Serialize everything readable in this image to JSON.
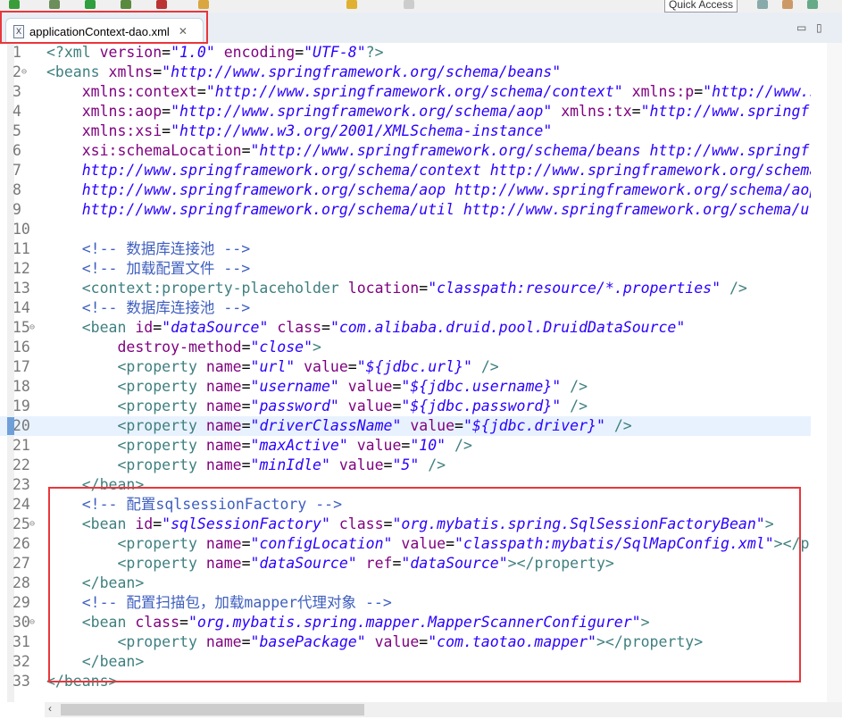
{
  "toolbar": {
    "quick_access": "Quick Access"
  },
  "tab": {
    "icon": "xml-file-icon",
    "label": "applicationContext-dao.xml",
    "close": "✕"
  },
  "colors": {
    "tag": "#3f7f7f",
    "attr": "#7f007f",
    "value": "#2a00ff",
    "comment": "#3f5fbf",
    "highlight": "#e8f2fe",
    "annotation": "#e8373c"
  },
  "highlighted_line": 20,
  "fold_lines": [
    2,
    15,
    25,
    30
  ],
  "lines": [
    {
      "n": "1",
      "tokens": [
        [
          "t",
          "<?xml "
        ],
        [
          "a",
          "version"
        ],
        [
          "p",
          "="
        ],
        [
          "v",
          "\"1.0\""
        ],
        [
          "p",
          " "
        ],
        [
          "a",
          "encoding"
        ],
        [
          "p",
          "="
        ],
        [
          "v",
          "\"UTF-8\""
        ],
        [
          "t",
          "?>"
        ]
      ]
    },
    {
      "n": "2",
      "tokens": [
        [
          "t",
          "<beans "
        ],
        [
          "a",
          "xmlns"
        ],
        [
          "p",
          "="
        ],
        [
          "v",
          "\"http://www.springframework.org/schema/beans\""
        ]
      ]
    },
    {
      "n": "3",
      "tokens": [
        [
          "p",
          "    "
        ],
        [
          "a",
          "xmlns:context"
        ],
        [
          "p",
          "="
        ],
        [
          "v",
          "\"http://www.springframework.org/schema/context\""
        ],
        [
          "p",
          " "
        ],
        [
          "a",
          "xmlns:p"
        ],
        [
          "p",
          "="
        ],
        [
          "v",
          "\"http://www.springframework.org/schema/p\""
        ]
      ]
    },
    {
      "n": "4",
      "tokens": [
        [
          "p",
          "    "
        ],
        [
          "a",
          "xmlns:aop"
        ],
        [
          "p",
          "="
        ],
        [
          "v",
          "\"http://www.springframework.org/schema/aop\""
        ],
        [
          "p",
          " "
        ],
        [
          "a",
          "xmlns:tx"
        ],
        [
          "p",
          "="
        ],
        [
          "v",
          "\"http://www.springframework.org/schema/tx\""
        ]
      ]
    },
    {
      "n": "5",
      "tokens": [
        [
          "p",
          "    "
        ],
        [
          "a",
          "xmlns:xsi"
        ],
        [
          "p",
          "="
        ],
        [
          "v",
          "\"http://www.w3.org/2001/XMLSchema-instance\""
        ]
      ]
    },
    {
      "n": "6",
      "tokens": [
        [
          "p",
          "    "
        ],
        [
          "a",
          "xsi:schemaLocation"
        ],
        [
          "p",
          "="
        ],
        [
          "v",
          "\"http://www.springframework.org/schema/beans http://www.springframework.org/schema/beans/spring-beans.xsd"
        ]
      ]
    },
    {
      "n": "7",
      "tokens": [
        [
          "p",
          "    "
        ],
        [
          "v",
          "http://www.springframework.org/schema/context http://www.springframework.org/schema/context/spring-context.xsd"
        ]
      ]
    },
    {
      "n": "8",
      "tokens": [
        [
          "p",
          "    "
        ],
        [
          "v",
          "http://www.springframework.org/schema/aop http://www.springframework.org/schema/aop/spring-aop.xsd"
        ]
      ]
    },
    {
      "n": "9",
      "tokens": [
        [
          "p",
          "    "
        ],
        [
          "v",
          "http://www.springframework.org/schema/util http://www.springframework.org/schema/util/spring-util.xsd\">"
        ]
      ]
    },
    {
      "n": "10",
      "tokens": []
    },
    {
      "n": "11",
      "tokens": [
        [
          "p",
          "    "
        ],
        [
          "c",
          "<!-- 数据库连接池 -->"
        ]
      ]
    },
    {
      "n": "12",
      "tokens": [
        [
          "p",
          "    "
        ],
        [
          "c",
          "<!-- 加载配置文件 -->"
        ]
      ]
    },
    {
      "n": "13",
      "tokens": [
        [
          "p",
          "    "
        ],
        [
          "t",
          "<context:property-placeholder "
        ],
        [
          "a",
          "location"
        ],
        [
          "p",
          "="
        ],
        [
          "v",
          "\"classpath:resource/*.properties\""
        ],
        [
          "p",
          " "
        ],
        [
          "t",
          "/>"
        ]
      ]
    },
    {
      "n": "14",
      "tokens": [
        [
          "p",
          "    "
        ],
        [
          "c",
          "<!-- 数据库连接池 -->"
        ]
      ]
    },
    {
      "n": "15",
      "tokens": [
        [
          "p",
          "    "
        ],
        [
          "t",
          "<bean "
        ],
        [
          "a",
          "id"
        ],
        [
          "p",
          "="
        ],
        [
          "v",
          "\"dataSource\""
        ],
        [
          "p",
          " "
        ],
        [
          "a",
          "class"
        ],
        [
          "p",
          "="
        ],
        [
          "v",
          "\"com.alibaba.druid.pool.DruidDataSource\""
        ]
      ]
    },
    {
      "n": "16",
      "tokens": [
        [
          "p",
          "        "
        ],
        [
          "a",
          "destroy-method"
        ],
        [
          "p",
          "="
        ],
        [
          "v",
          "\"close\""
        ],
        [
          "t",
          ">"
        ]
      ]
    },
    {
      "n": "17",
      "tokens": [
        [
          "p",
          "        "
        ],
        [
          "t",
          "<property "
        ],
        [
          "a",
          "name"
        ],
        [
          "p",
          "="
        ],
        [
          "v",
          "\"url\""
        ],
        [
          "p",
          " "
        ],
        [
          "a",
          "value"
        ],
        [
          "p",
          "="
        ],
        [
          "v",
          "\"${jdbc.url}\""
        ],
        [
          "p",
          " "
        ],
        [
          "t",
          "/>"
        ]
      ]
    },
    {
      "n": "18",
      "tokens": [
        [
          "p",
          "        "
        ],
        [
          "t",
          "<property "
        ],
        [
          "a",
          "name"
        ],
        [
          "p",
          "="
        ],
        [
          "v",
          "\"username\""
        ],
        [
          "p",
          " "
        ],
        [
          "a",
          "value"
        ],
        [
          "p",
          "="
        ],
        [
          "v",
          "\"${jdbc.username}\""
        ],
        [
          "p",
          " "
        ],
        [
          "t",
          "/>"
        ]
      ]
    },
    {
      "n": "19",
      "tokens": [
        [
          "p",
          "        "
        ],
        [
          "t",
          "<property "
        ],
        [
          "a",
          "name"
        ],
        [
          "p",
          "="
        ],
        [
          "v",
          "\"password\""
        ],
        [
          "p",
          " "
        ],
        [
          "a",
          "value"
        ],
        [
          "p",
          "="
        ],
        [
          "v",
          "\"${jdbc.password}\""
        ],
        [
          "p",
          " "
        ],
        [
          "t",
          "/>"
        ]
      ]
    },
    {
      "n": "20",
      "tokens": [
        [
          "p",
          "        "
        ],
        [
          "t",
          "<property "
        ],
        [
          "a",
          "name"
        ],
        [
          "p",
          "="
        ],
        [
          "v",
          "\"driverClassName\""
        ],
        [
          "p",
          " "
        ],
        [
          "a",
          "value"
        ],
        [
          "p",
          "="
        ],
        [
          "v",
          "\"${jdbc.driver}\""
        ],
        [
          "p",
          " "
        ],
        [
          "t",
          "/>"
        ]
      ]
    },
    {
      "n": "21",
      "tokens": [
        [
          "p",
          "        "
        ],
        [
          "t",
          "<property "
        ],
        [
          "a",
          "name"
        ],
        [
          "p",
          "="
        ],
        [
          "v",
          "\"maxActive\""
        ],
        [
          "p",
          " "
        ],
        [
          "a",
          "value"
        ],
        [
          "p",
          "="
        ],
        [
          "v",
          "\"10\""
        ],
        [
          "p",
          " "
        ],
        [
          "t",
          "/>"
        ]
      ]
    },
    {
      "n": "22",
      "tokens": [
        [
          "p",
          "        "
        ],
        [
          "t",
          "<property "
        ],
        [
          "a",
          "name"
        ],
        [
          "p",
          "="
        ],
        [
          "v",
          "\"minIdle\""
        ],
        [
          "p",
          " "
        ],
        [
          "a",
          "value"
        ],
        [
          "p",
          "="
        ],
        [
          "v",
          "\"5\""
        ],
        [
          "p",
          " "
        ],
        [
          "t",
          "/>"
        ]
      ]
    },
    {
      "n": "23",
      "tokens": [
        [
          "p",
          "    "
        ],
        [
          "t",
          "</bean>"
        ]
      ]
    },
    {
      "n": "24",
      "tokens": [
        [
          "p",
          "    "
        ],
        [
          "c",
          "<!-- 配置sqlsessionFactory -->"
        ]
      ]
    },
    {
      "n": "25",
      "tokens": [
        [
          "p",
          "    "
        ],
        [
          "t",
          "<bean "
        ],
        [
          "a",
          "id"
        ],
        [
          "p",
          "="
        ],
        [
          "v",
          "\"sqlSessionFactory\""
        ],
        [
          "p",
          " "
        ],
        [
          "a",
          "class"
        ],
        [
          "p",
          "="
        ],
        [
          "v",
          "\"org.mybatis.spring.SqlSessionFactoryBean\""
        ],
        [
          "t",
          ">"
        ]
      ]
    },
    {
      "n": "26",
      "tokens": [
        [
          "p",
          "        "
        ],
        [
          "t",
          "<property "
        ],
        [
          "a",
          "name"
        ],
        [
          "p",
          "="
        ],
        [
          "v",
          "\"configLocation\""
        ],
        [
          "p",
          " "
        ],
        [
          "a",
          "value"
        ],
        [
          "p",
          "="
        ],
        [
          "v",
          "\"classpath:mybatis/SqlMapConfig.xml\""
        ],
        [
          "t",
          "></property>"
        ]
      ]
    },
    {
      "n": "27",
      "tokens": [
        [
          "p",
          "        "
        ],
        [
          "t",
          "<property "
        ],
        [
          "a",
          "name"
        ],
        [
          "p",
          "="
        ],
        [
          "v",
          "\"dataSource\""
        ],
        [
          "p",
          " "
        ],
        [
          "a",
          "ref"
        ],
        [
          "p",
          "="
        ],
        [
          "v",
          "\"dataSource\""
        ],
        [
          "t",
          "></property>"
        ]
      ]
    },
    {
      "n": "28",
      "tokens": [
        [
          "p",
          "    "
        ],
        [
          "t",
          "</bean>"
        ]
      ]
    },
    {
      "n": "29",
      "tokens": [
        [
          "p",
          "    "
        ],
        [
          "c",
          "<!-- 配置扫描包，加载mapper代理对象 -->"
        ]
      ]
    },
    {
      "n": "30",
      "tokens": [
        [
          "p",
          "    "
        ],
        [
          "t",
          "<bean "
        ],
        [
          "a",
          "class"
        ],
        [
          "p",
          "="
        ],
        [
          "v",
          "\"org.mybatis.spring.mapper.MapperScannerConfigurer\""
        ],
        [
          "t",
          ">"
        ]
      ]
    },
    {
      "n": "31",
      "tokens": [
        [
          "p",
          "        "
        ],
        [
          "t",
          "<property "
        ],
        [
          "a",
          "name"
        ],
        [
          "p",
          "="
        ],
        [
          "v",
          "\"basePackage\""
        ],
        [
          "p",
          " "
        ],
        [
          "a",
          "value"
        ],
        [
          "p",
          "="
        ],
        [
          "v",
          "\"com.taotao.mapper\""
        ],
        [
          "t",
          "></property>"
        ]
      ]
    },
    {
      "n": "32",
      "tokens": [
        [
          "p",
          "    "
        ],
        [
          "t",
          "</bean>"
        ]
      ]
    },
    {
      "n": "33",
      "tokens": [
        [
          "t",
          "</beans>"
        ]
      ]
    }
  ]
}
